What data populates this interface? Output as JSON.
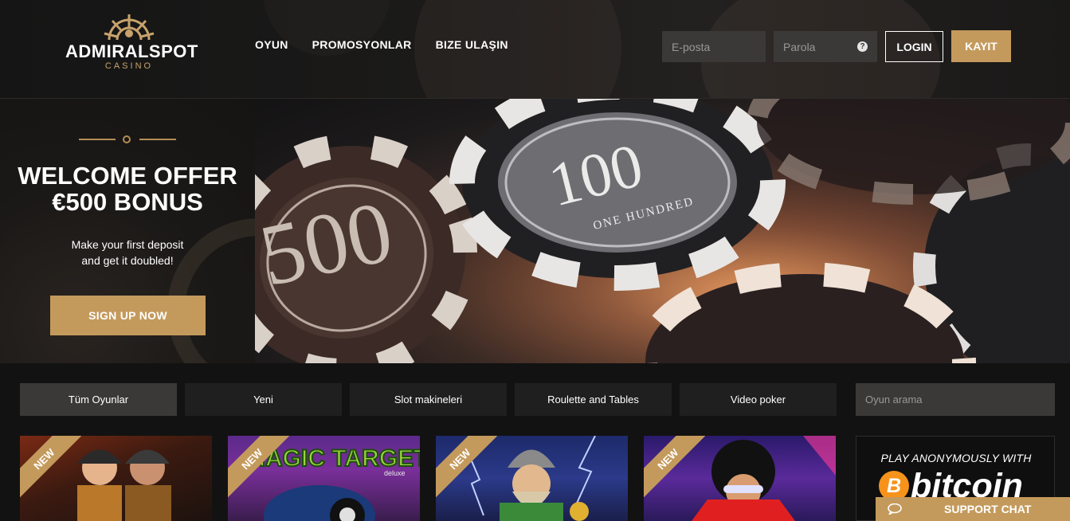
{
  "brand": {
    "name": "ADMIRALSPOT",
    "sub": "CASINO",
    "accent": "#c49a5c"
  },
  "nav": {
    "items": [
      "OYUN",
      "PROMOSYONLAR",
      "BIZE ULAŞIN"
    ]
  },
  "login": {
    "email_placeholder": "E-posta",
    "password_placeholder": "Parola",
    "help_icon": "question-icon",
    "login_label": "LOGIN",
    "register_label": "KAYIT"
  },
  "hero": {
    "title_line1": "WELCOME OFFER",
    "title_line2": "€500 BONUS",
    "text_line1": "Make your first deposit",
    "text_line2": "and get it doubled!",
    "cta_label": "SIGN UP NOW",
    "chip_labels": {
      "big": "100",
      "small": "ONE HUNDRED",
      "left": "500"
    }
  },
  "filters": {
    "tabs": [
      "Tüm Oyunlar",
      "Yeni",
      "Slot makineleri",
      "Roulette and Tables",
      "Video poker"
    ],
    "active_index": 0,
    "search_placeholder": "Oyun arama"
  },
  "games": [
    {
      "badge": "NEW"
    },
    {
      "badge": "NEW",
      "title_art": "MAGIC TARGET",
      "title_sub": "deluxe"
    },
    {
      "badge": "NEW"
    },
    {
      "badge": "NEW"
    }
  ],
  "bitcoin": {
    "title": "PLAY ANONYMOUSLY WITH",
    "word": "bitcoin",
    "coin_symbol": "B"
  },
  "support": {
    "label": "SUPPORT CHAT",
    "icon": "chat-bubble-icon"
  }
}
